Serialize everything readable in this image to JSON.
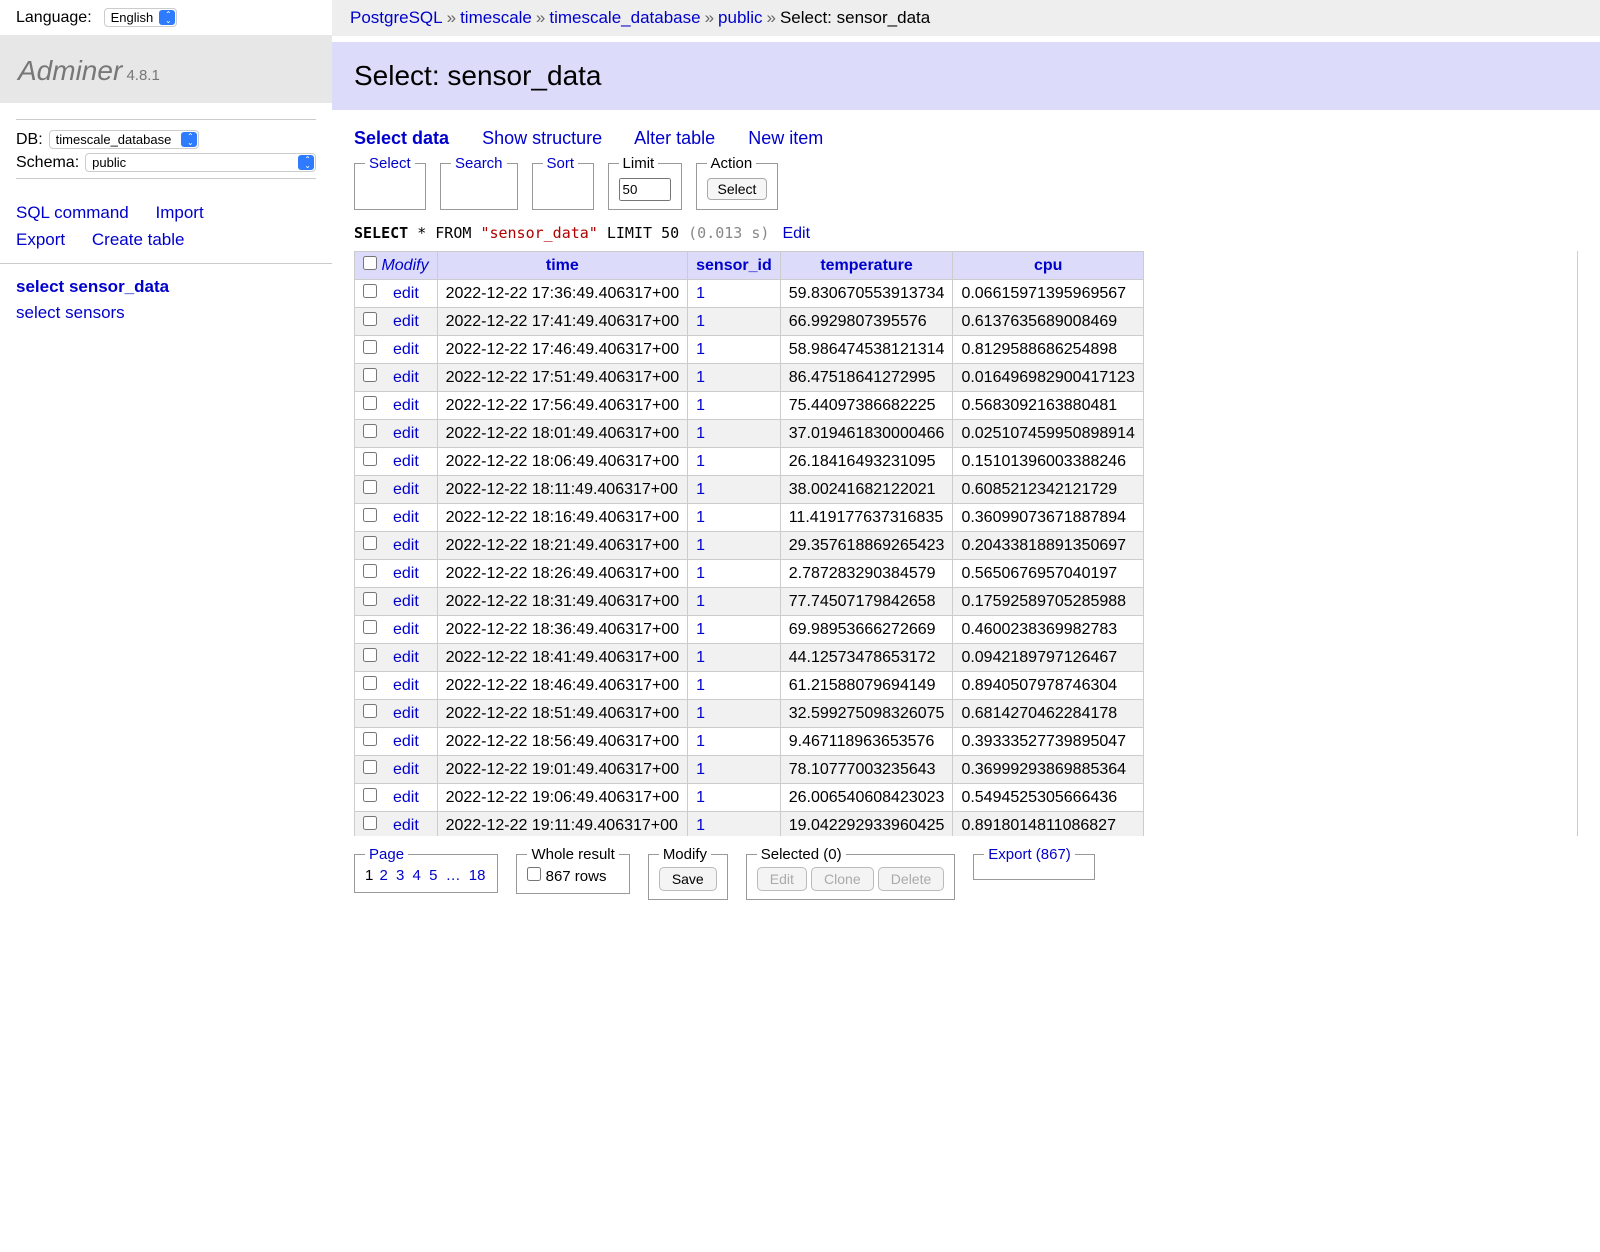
{
  "lang": {
    "label": "Language:",
    "value": "English"
  },
  "brand": {
    "name": "Adminer",
    "version": "4.8.1"
  },
  "db_select": {
    "label": "DB:",
    "value": "timescale_database"
  },
  "schema_select": {
    "label": "Schema:",
    "value": "public"
  },
  "side_links": {
    "sql_command": "SQL command",
    "import": "Import",
    "export": "Export",
    "create_table": "Create table"
  },
  "side_tables": [
    {
      "prefix": "select",
      "name": "sensor_data",
      "active": true
    },
    {
      "prefix": "select",
      "name": "sensors",
      "active": false
    }
  ],
  "crumbs": [
    "PostgreSQL",
    "timescale",
    "timescale_database",
    "public",
    "Select: sensor_data"
  ],
  "page_title": "Select: sensor_data",
  "toolbar": {
    "select_data": "Select data",
    "show_structure": "Show structure",
    "alter_table": "Alter table",
    "new_item": "New item"
  },
  "fieldsets": {
    "select": "Select",
    "search": "Search",
    "sort": "Sort",
    "limit": "Limit",
    "limit_value": "50",
    "action": "Action",
    "action_button": "Select"
  },
  "sql": {
    "select": "SELECT",
    "star": "*",
    "from": "FROM",
    "table": "\"sensor_data\"",
    "limit_kw": "LIMIT",
    "limit_n": "50",
    "timing": "(0.013 s)",
    "edit": "Edit"
  },
  "columns": {
    "modify": "Modify",
    "time": "time",
    "sensor_id": "sensor_id",
    "temperature": "temperature",
    "cpu": "cpu"
  },
  "edit_label": "edit",
  "rows": [
    {
      "time": "2022-12-22 17:36:49.406317+00",
      "sensor_id": "1",
      "temperature": "59.830670553913734",
      "cpu": "0.06615971395969567"
    },
    {
      "time": "2022-12-22 17:41:49.406317+00",
      "sensor_id": "1",
      "temperature": "66.9929807395576",
      "cpu": "0.6137635689008469"
    },
    {
      "time": "2022-12-22 17:46:49.406317+00",
      "sensor_id": "1",
      "temperature": "58.986474538121314",
      "cpu": "0.8129588686254898"
    },
    {
      "time": "2022-12-22 17:51:49.406317+00",
      "sensor_id": "1",
      "temperature": "86.47518641272995",
      "cpu": "0.016496982900417123"
    },
    {
      "time": "2022-12-22 17:56:49.406317+00",
      "sensor_id": "1",
      "temperature": "75.44097386682225",
      "cpu": "0.5683092163880481"
    },
    {
      "time": "2022-12-22 18:01:49.406317+00",
      "sensor_id": "1",
      "temperature": "37.019461830000466",
      "cpu": "0.025107459950898914"
    },
    {
      "time": "2022-12-22 18:06:49.406317+00",
      "sensor_id": "1",
      "temperature": "26.18416493231095",
      "cpu": "0.15101396003388246"
    },
    {
      "time": "2022-12-22 18:11:49.406317+00",
      "sensor_id": "1",
      "temperature": "38.00241682122021",
      "cpu": "0.6085212342121729"
    },
    {
      "time": "2022-12-22 18:16:49.406317+00",
      "sensor_id": "1",
      "temperature": "11.419177637316835",
      "cpu": "0.36099073671887894"
    },
    {
      "time": "2022-12-22 18:21:49.406317+00",
      "sensor_id": "1",
      "temperature": "29.357618869265423",
      "cpu": "0.20433818891350697"
    },
    {
      "time": "2022-12-22 18:26:49.406317+00",
      "sensor_id": "1",
      "temperature": "2.787283290384579",
      "cpu": "0.5650676957040197"
    },
    {
      "time": "2022-12-22 18:31:49.406317+00",
      "sensor_id": "1",
      "temperature": "77.74507179842658",
      "cpu": "0.17592589705285988"
    },
    {
      "time": "2022-12-22 18:36:49.406317+00",
      "sensor_id": "1",
      "temperature": "69.98953666272669",
      "cpu": "0.4600238369982783"
    },
    {
      "time": "2022-12-22 18:41:49.406317+00",
      "sensor_id": "1",
      "temperature": "44.12573478653172",
      "cpu": "0.0942189797126467"
    },
    {
      "time": "2022-12-22 18:46:49.406317+00",
      "sensor_id": "1",
      "temperature": "61.21588079694149",
      "cpu": "0.8940507978746304"
    },
    {
      "time": "2022-12-22 18:51:49.406317+00",
      "sensor_id": "1",
      "temperature": "32.599275098326075",
      "cpu": "0.6814270462284178"
    },
    {
      "time": "2022-12-22 18:56:49.406317+00",
      "sensor_id": "1",
      "temperature": "9.467118963653576",
      "cpu": "0.39333527739895047"
    },
    {
      "time": "2022-12-22 19:01:49.406317+00",
      "sensor_id": "1",
      "temperature": "78.10777003235643",
      "cpu": "0.36999293869885364"
    },
    {
      "time": "2022-12-22 19:06:49.406317+00",
      "sensor_id": "1",
      "temperature": "26.006540608423023",
      "cpu": "0.5494525305666436"
    },
    {
      "time": "2022-12-22 19:11:49.406317+00",
      "sensor_id": "1",
      "temperature": "19.042292933960425",
      "cpu": "0.8918014811086827"
    }
  ],
  "footer": {
    "page_legend": "Page",
    "pages": [
      "1",
      "2",
      "3",
      "4",
      "5",
      "…",
      "18"
    ],
    "whole_legend": "Whole result",
    "whole_label": "867 rows",
    "modify_legend": "Modify",
    "save": "Save",
    "selected_legend": "Selected (0)",
    "edit": "Edit",
    "clone": "Clone",
    "delete": "Delete",
    "export_legend": "Export (867)"
  }
}
